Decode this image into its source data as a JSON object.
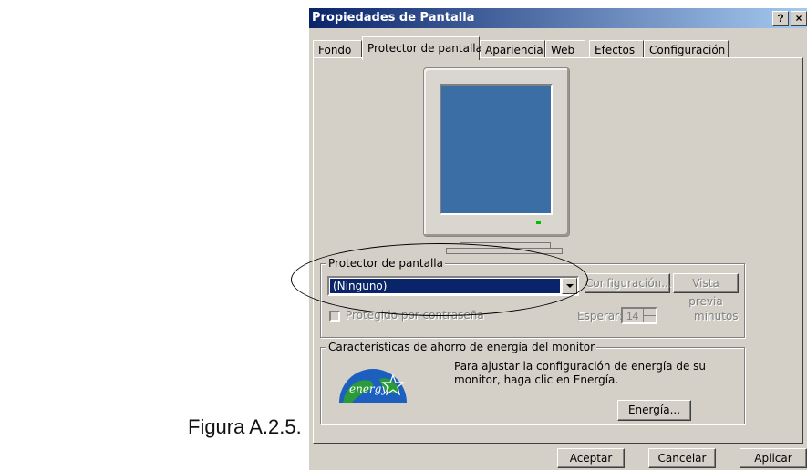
{
  "caption": "Figura A.2.5.",
  "window": {
    "title": "Propiedades de Pantalla",
    "help_label": "?",
    "close_label": "×"
  },
  "tabs": [
    {
      "label": "Fondo"
    },
    {
      "label": "Protector de pantalla",
      "active": true
    },
    {
      "label": "Apariencia"
    },
    {
      "label": "Web"
    },
    {
      "label": "Efectos"
    },
    {
      "label": "Configuración"
    }
  ],
  "screensaver": {
    "group_label": "Protector de pantalla",
    "selected": "(Ninguno)",
    "config_button": "Configuración...",
    "preview_button": "Vista previa",
    "password_label": "Protegido por contraseña",
    "wait_label": "Esperar:",
    "wait_value": "14",
    "minutes_label": "minutos"
  },
  "energy": {
    "group_label": "Características de ahorro de energía del monitor",
    "info_text": "Para ajustar la configuración de energía de su monitor, haga clic en Energía.",
    "button": "Energía...",
    "logo_text": "energy"
  },
  "footer": {
    "ok": "Aceptar",
    "cancel": "Cancelar",
    "apply": "Aplicar"
  },
  "colors": {
    "title_bar": "#0a246a",
    "screen": "#3a6ea5",
    "dialog": "#d4d0c8"
  }
}
